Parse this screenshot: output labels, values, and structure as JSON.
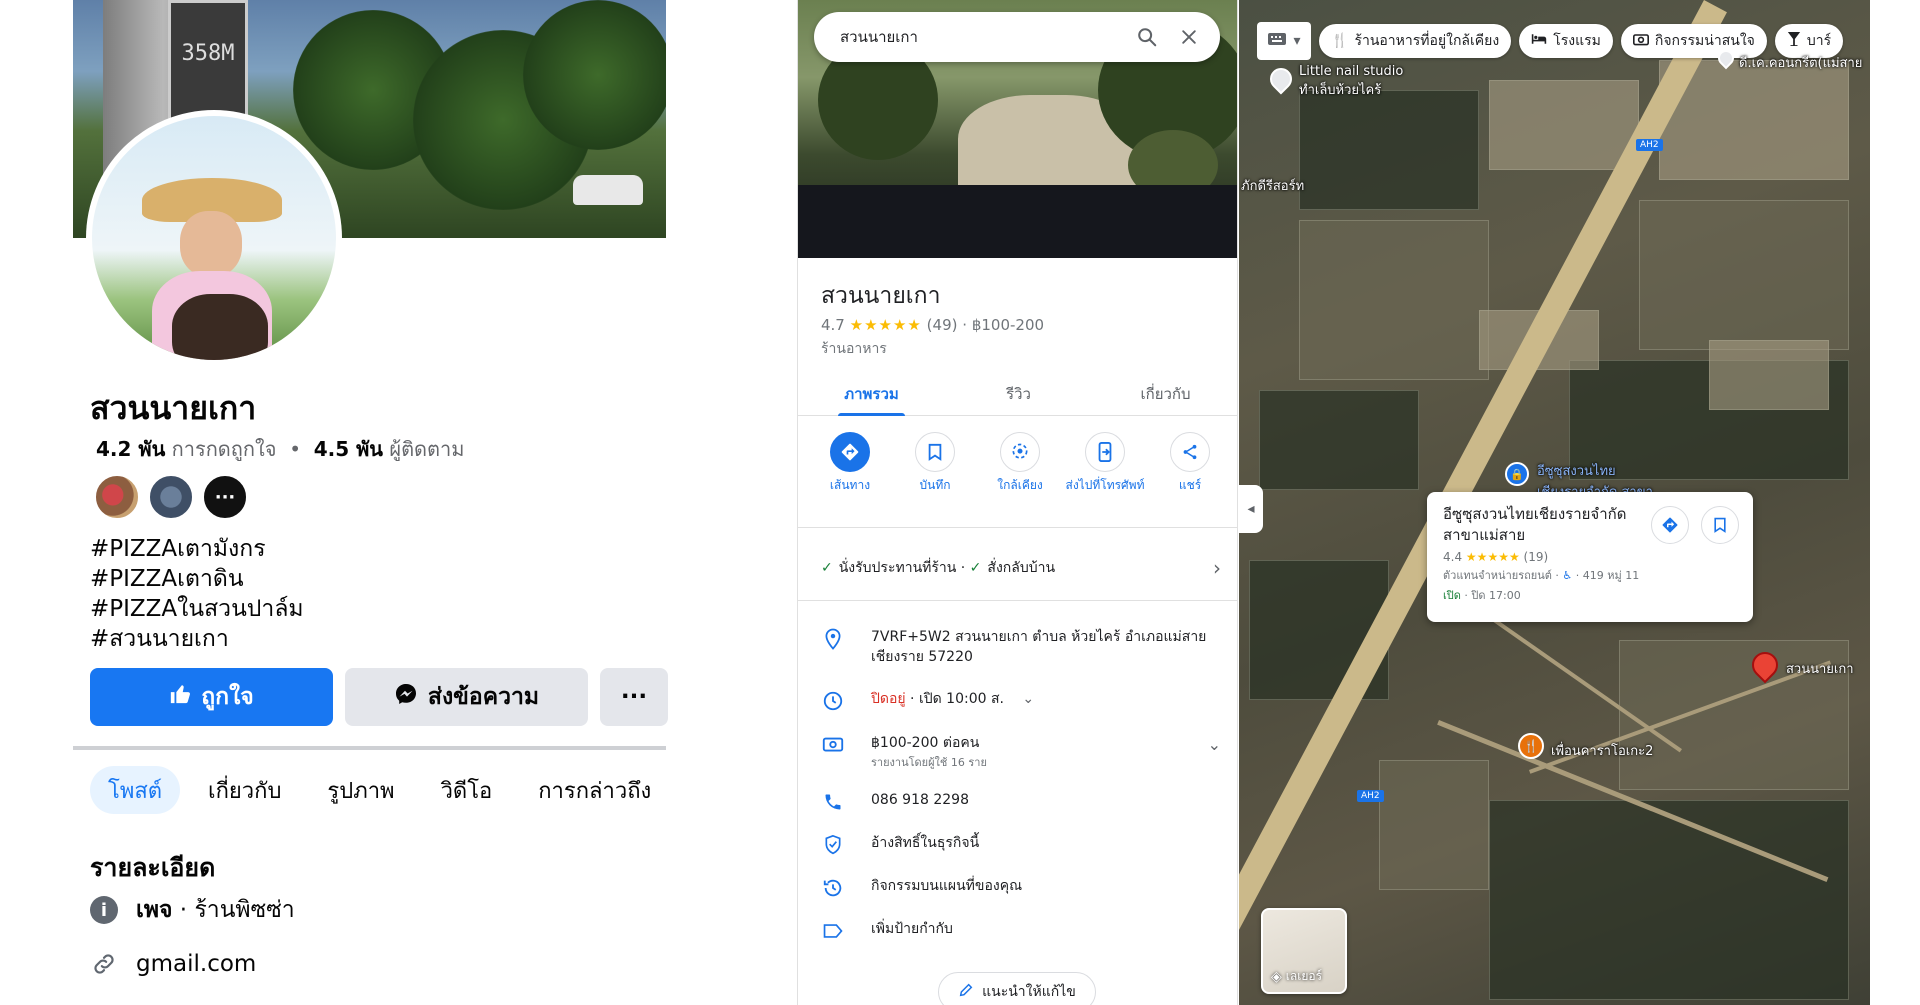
{
  "facebook": {
    "page_name": "สวนนายเกา",
    "likes_count": "4.2 พัน",
    "likes_label": "การกดถูกใจ",
    "followers_count": "4.5 พัน",
    "followers_label": "ผู้ติดตาม",
    "bio_lines": [
      "#PIZZAเตามังกร",
      "#PIZZAเตาดิน",
      "#PIZZAในสวนปาล์ม",
      "#สวนนายเกา"
    ],
    "like_button": "ถูกใจ",
    "message_button": "ส่งข้อความ",
    "more_button": "···",
    "tabs": [
      "โพสต์",
      "เกี่ยวกับ",
      "รูปภาพ",
      "วิดีโอ",
      "การกล่าวถึง"
    ],
    "details_title": "รายละเอียด",
    "page_type_prefix": "เพจ",
    "page_type": "ร้านพิซซ่า",
    "email": "gmail.com",
    "cover_sign_text": "358M",
    "colors": {
      "brand_blue": "#1877f2",
      "tab_active_bg": "#e7f3ff"
    }
  },
  "gmaps": {
    "search_value": "สวนนายเกา",
    "place_name": "สวนนายเกา",
    "rating": "4.7",
    "stars": "★★★★★",
    "review_count": "(49)",
    "price": "฿100-200",
    "category": "ร้านอาหาร",
    "tabs": [
      "ภาพรวม",
      "รีวิว",
      "เกี่ยวกับ"
    ],
    "actions": [
      {
        "label": "เส้นทาง",
        "icon": "directions-icon"
      },
      {
        "label": "บันทึก",
        "icon": "bookmark-icon"
      },
      {
        "label": "ใกล้เคียง",
        "icon": "nearby-icon"
      },
      {
        "label": "ส่งไปที่โทรศัพท์",
        "icon": "send-to-phone-icon"
      },
      {
        "label": "แชร์",
        "icon": "share-icon"
      }
    ],
    "services": [
      "นั่งรับประทานที่ร้าน",
      "สั่งกลับบ้าน"
    ],
    "address": "7VRF+5W2 สวนนายเกา ตำบล ห้วยไคร้ อำเภอแม่สาย เชียงราย 57220",
    "hours_status": "ปิดอยู่",
    "hours_next": "เปิด 10:00 ส.",
    "price_row": "฿100-200 ต่อคน",
    "price_sub": "รายงานโดยผู้ใช้ 16 ราย",
    "phone": "086 918 2298",
    "claim": "อ้างสิทธิ์ในธุรกิจนี้",
    "activity": "กิจกรรมบนแผนที่ของคุณ",
    "add_label": "เพิ่มป้ายกำกับ",
    "suggest_edit": "แนะนำให้แก้ไข",
    "colors": {
      "accent": "#1a73e8",
      "closed": "#d93025",
      "check": "#188038",
      "star": "#fbbc04"
    }
  },
  "map": {
    "chips": [
      {
        "label": "ร้านอาหารที่อยู่ใกล้เคียง",
        "icon": "restaurant-icon"
      },
      {
        "label": "โรงแรม",
        "icon": "hotel-icon"
      },
      {
        "label": "กิจกรรมน่าสนใจ",
        "icon": "camera-icon"
      },
      {
        "label": "บาร์",
        "icon": "bar-icon"
      }
    ],
    "labels": {
      "nail_studio": "Little nail studio",
      "nail_studio_sub": "ทำเล็บห้วยไคร้",
      "resort": "ภักดีรีสอร์ท",
      "top_right": "ดี.เค.คอนกรีต(แม่สาย",
      "blue_place": "อีซูซุสงวนไทย",
      "blue_place_sub": "เชียงรายจำกัด สาขา...",
      "target": "สวนนายเกา",
      "karaoke": "เพื่อนคาราโอเกะ2",
      "road_ah2": "AH2"
    },
    "card": {
      "title": "อีซูซุสงวนไทยเชียงรายจำกัด สาขาแม่สาย",
      "rating": "4.4",
      "stars": "★★★★★",
      "reviews": "(19)",
      "category": "ตัวแทนจำหน่ายรถยนต์",
      "address": "419 หมู่ 11",
      "open_label": "เปิด",
      "close_time": "ปิด 17:00"
    },
    "layers_label": "เลเยอร์"
  }
}
